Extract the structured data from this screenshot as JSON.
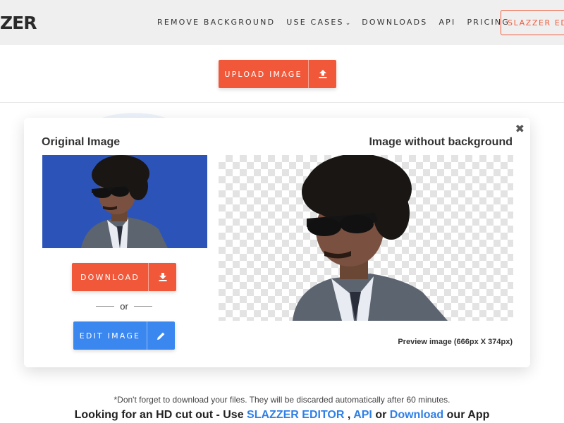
{
  "nav": {
    "logo": "ZER",
    "links": [
      "REMOVE BACKGROUND",
      "USE CASES",
      "DOWNLOADS",
      "API",
      "PRICING"
    ],
    "use_cases_chevron": "⌄",
    "cta": "SLAZZER EDITOR"
  },
  "upload": {
    "label": "UPLOAD IMAGE",
    "icon": "upload-icon"
  },
  "modal": {
    "original_title": "Original Image",
    "result_title": "Image without background",
    "close_glyph": "✖",
    "download_label": "DOWNLOAD",
    "or_text": "or",
    "edit_label": "EDIT IMAGE",
    "preview_text": "Preview image (666px X 374px)"
  },
  "footer": {
    "note": "*Don't forget to download your files. They will be discarded automatically after 60 minutes.",
    "promo_prefix": "Looking for an HD cut out - Use",
    "promo_editor": "SLAZZER EDITOR",
    "promo_comma": ",",
    "promo_api": "API",
    "promo_or": "or",
    "promo_download": "Download",
    "promo_suffix": "our App"
  },
  "colors": {
    "accent": "#f1583a",
    "edit_blue": "#3b87f0",
    "link_blue": "#2f7fe6",
    "photo_bg": "#2c54b8"
  }
}
